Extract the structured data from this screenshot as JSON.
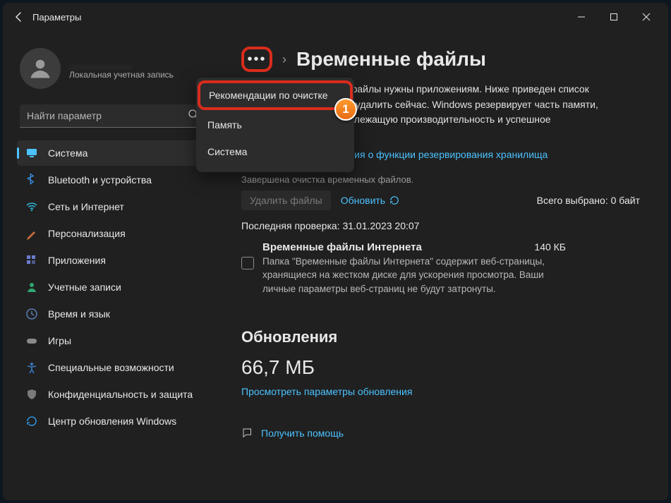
{
  "window": {
    "title": "Параметры"
  },
  "account": {
    "name": "__________",
    "subtitle": "Локальная учетная запись"
  },
  "search": {
    "placeholder": "Найти параметр"
  },
  "nav": [
    {
      "label": "Система",
      "icon": "monitor",
      "color": "#4cc2ff",
      "active": true
    },
    {
      "label": "Bluetooth и устройства",
      "icon": "bluetooth",
      "color": "#3a8ee6"
    },
    {
      "label": "Сеть и Интернет",
      "icon": "wifi",
      "color": "#2fb4d8"
    },
    {
      "label": "Персонализация",
      "icon": "brush",
      "color": "#c46b3d"
    },
    {
      "label": "Приложения",
      "icon": "apps",
      "color": "#6b7dd1"
    },
    {
      "label": "Учетные записи",
      "icon": "person",
      "color": "#2fa86f"
    },
    {
      "label": "Время и язык",
      "icon": "clock",
      "color": "#5a7db5"
    },
    {
      "label": "Игры",
      "icon": "gamepad",
      "color": "#8a8a8a"
    },
    {
      "label": "Специальные возможности",
      "icon": "accessibility",
      "color": "#3a7cc9"
    },
    {
      "label": "Конфиденциальность и защита",
      "icon": "shield",
      "color": "#7a7a7a"
    },
    {
      "label": "Центр обновления Windows",
      "icon": "update",
      "color": "#2f8fd8"
    }
  ],
  "flyout": {
    "items": [
      "Рекомендации по очистке",
      "Память",
      "Система"
    ]
  },
  "page": {
    "title": "Временные файлы",
    "description": "Некоторые временные файлы нужны приложениям. Ниже приведен список файлов, которые можно удалить сейчас. Windows резервирует часть памяти, чтобы обеспечивать надлежащую производительность и успешное обновление устройства.",
    "more_link": "Дополнительные сведения о функции резервирования хранилища",
    "cleanup_done": "Завершена очистка временных файлов.",
    "delete_btn": "Удалить файлы",
    "refresh_btn": "Обновить",
    "total_selected": "Всего выбрано: 0 байт",
    "last_check": "Последняя проверка: 31.01.2023 20:07",
    "item": {
      "title": "Временные файлы Интернета",
      "size": "140 КБ",
      "desc": "Папка \"Временные файлы Интернета\" содержит веб-страницы, хранящиеся на жестком диске для ускорения просмотра. Ваши личные параметры веб-страниц не будут затронуты."
    },
    "updates_header": "Обновления",
    "updates_size": "66,7 МБ",
    "updates_link": "Просмотреть параметры обновления",
    "help": "Получить помощь"
  },
  "annotation": {
    "badge": "1"
  }
}
